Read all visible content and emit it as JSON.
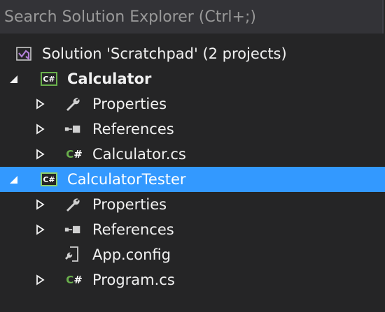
{
  "search": {
    "placeholder": "Search Solution Explorer (Ctrl+;)"
  },
  "colors": {
    "selection": "#3399ff",
    "csharp_green": "#6ab04c",
    "solution_purple": "#b180d7"
  },
  "tree": {
    "solution_label": "Solution 'Scratchpad' (2 projects)",
    "projects": [
      {
        "name": "Calculator",
        "items": [
          {
            "label": "Properties",
            "icon": "wrench-icon"
          },
          {
            "label": "References",
            "icon": "references-icon"
          },
          {
            "label": "Calculator.cs",
            "icon": "csharp-file-icon"
          }
        ]
      },
      {
        "name": "CalculatorTester",
        "items": [
          {
            "label": "Properties",
            "icon": "wrench-icon"
          },
          {
            "label": "References",
            "icon": "references-icon"
          },
          {
            "label": "App.config",
            "icon": "config-file-icon"
          },
          {
            "label": "Program.cs",
            "icon": "csharp-file-icon"
          }
        ]
      }
    ],
    "cs_glyph": "C#",
    "cs_small_c": "C",
    "cs_small_hash": "#"
  }
}
